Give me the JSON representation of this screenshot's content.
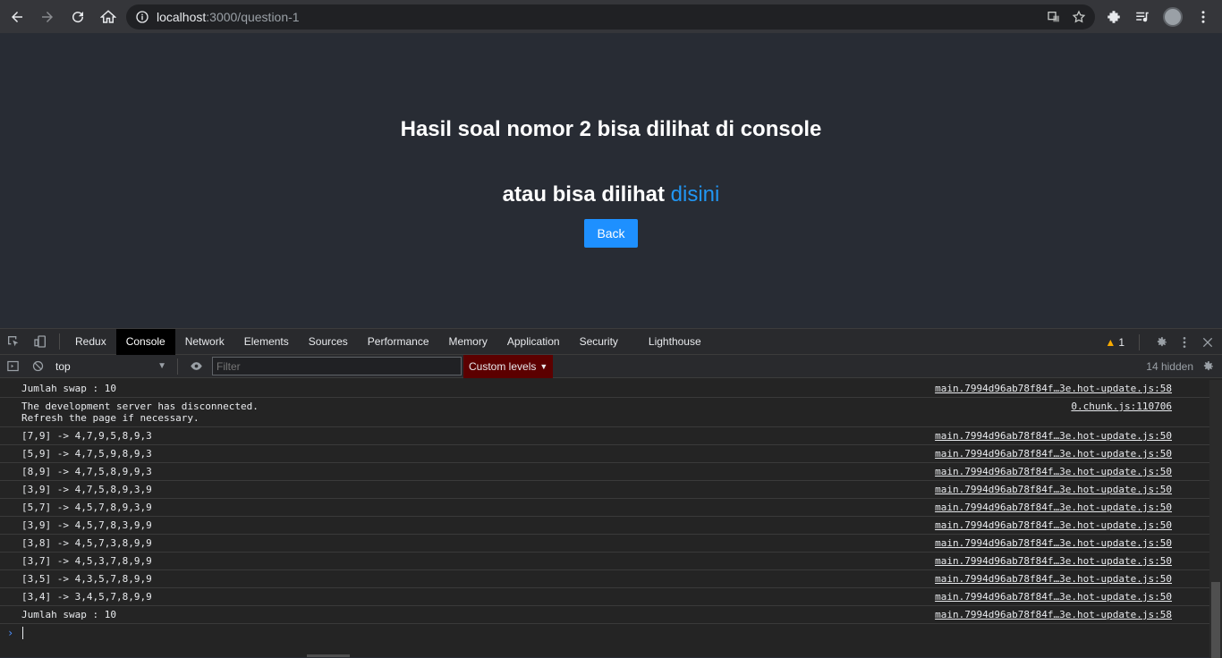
{
  "browser": {
    "url_host": "localhost",
    "url_path": ":3000/question-1"
  },
  "page": {
    "heading1": "Hasil soal nomor 2 bisa dilihat di console",
    "heading2_prefix": "atau bisa dilihat ",
    "heading2_link": "disini",
    "back_label": "Back",
    "link_color": "#2196f3",
    "button_color": "#1e90ff"
  },
  "devtools": {
    "tabs": [
      "Redux",
      "Console",
      "Network",
      "Elements",
      "Sources",
      "Performance",
      "Memory",
      "Application",
      "Security",
      "Lighthouse"
    ],
    "active_tab": "Console",
    "warning_count": "1",
    "context": "top",
    "filter_placeholder": "Filter",
    "levels_label": "Custom levels",
    "hidden_label": "14 hidden",
    "messages": [
      {
        "text": "Jumlah swap : 10",
        "src": "main.7994d96ab78f84f…3e.hot-update.js:58"
      },
      {
        "text": "The development server has disconnected.\nRefresh the page if necessary.",
        "src": "0.chunk.js:110706"
      },
      {
        "text": "[7,9] -> 4,7,9,5,8,9,3",
        "src": "main.7994d96ab78f84f…3e.hot-update.js:50"
      },
      {
        "text": "[5,9] -> 4,7,5,9,8,9,3",
        "src": "main.7994d96ab78f84f…3e.hot-update.js:50"
      },
      {
        "text": "[8,9] -> 4,7,5,8,9,9,3",
        "src": "main.7994d96ab78f84f…3e.hot-update.js:50"
      },
      {
        "text": "[3,9] -> 4,7,5,8,9,3,9",
        "src": "main.7994d96ab78f84f…3e.hot-update.js:50"
      },
      {
        "text": "[5,7] -> 4,5,7,8,9,3,9",
        "src": "main.7994d96ab78f84f…3e.hot-update.js:50"
      },
      {
        "text": "[3,9] -> 4,5,7,8,3,9,9",
        "src": "main.7994d96ab78f84f…3e.hot-update.js:50"
      },
      {
        "text": "[3,8] -> 4,5,7,3,8,9,9",
        "src": "main.7994d96ab78f84f…3e.hot-update.js:50"
      },
      {
        "text": "[3,7] -> 4,5,3,7,8,9,9",
        "src": "main.7994d96ab78f84f…3e.hot-update.js:50"
      },
      {
        "text": "[3,5] -> 4,3,5,7,8,9,9",
        "src": "main.7994d96ab78f84f…3e.hot-update.js:50"
      },
      {
        "text": "[3,4] -> 3,4,5,7,8,9,9",
        "src": "main.7994d96ab78f84f…3e.hot-update.js:50"
      },
      {
        "text": "Jumlah swap : 10",
        "src": "main.7994d96ab78f84f…3e.hot-update.js:58"
      }
    ]
  }
}
